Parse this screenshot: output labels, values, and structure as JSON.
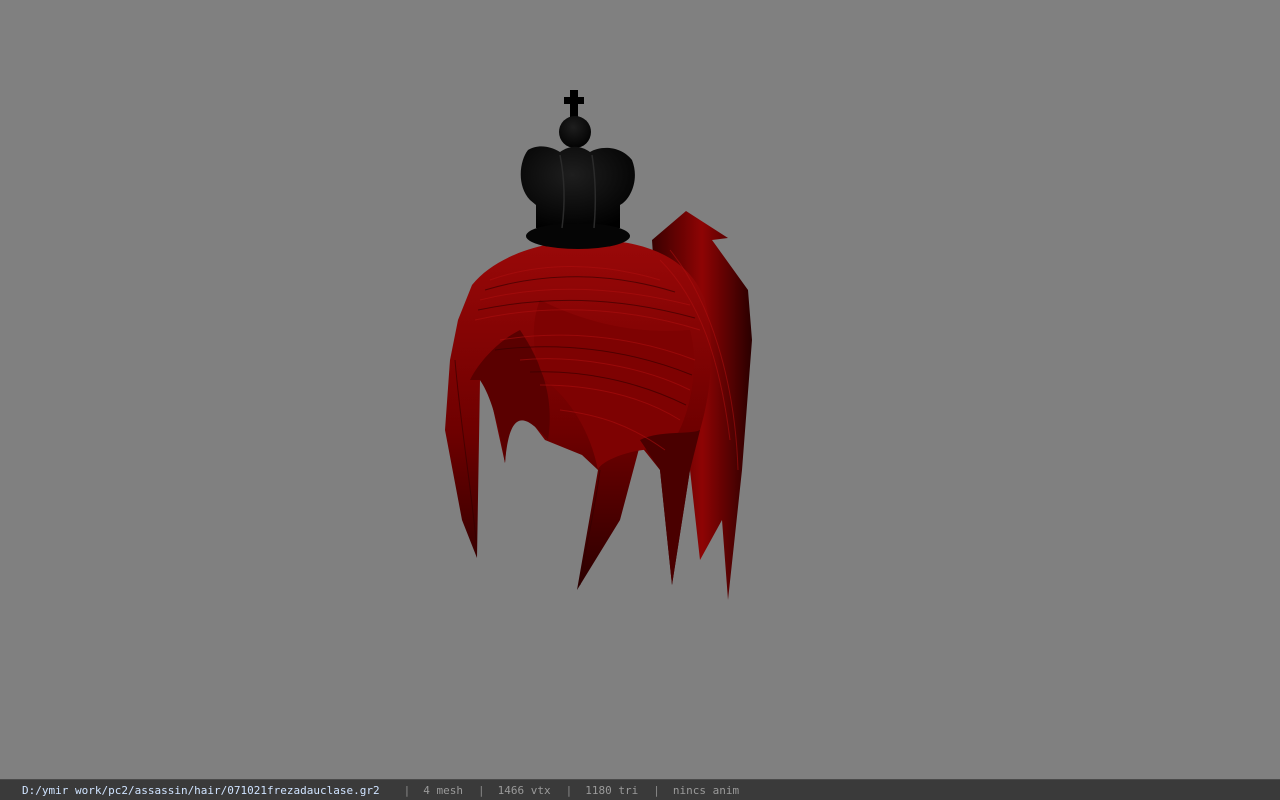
{
  "viewport": {
    "background": "#808080",
    "model": {
      "parts": [
        "crown",
        "hair"
      ],
      "crown_color": "#000000",
      "hair_color": "#8a0000"
    }
  },
  "status_bar": {
    "file_path": "D:/ymir work/pc2/assassin/hair/071021frezadauclase.gr2",
    "separator": "|",
    "mesh": "4 mesh",
    "vtx": "1466 vtx",
    "tri": "1180 tri",
    "anim": "nincs anim"
  }
}
